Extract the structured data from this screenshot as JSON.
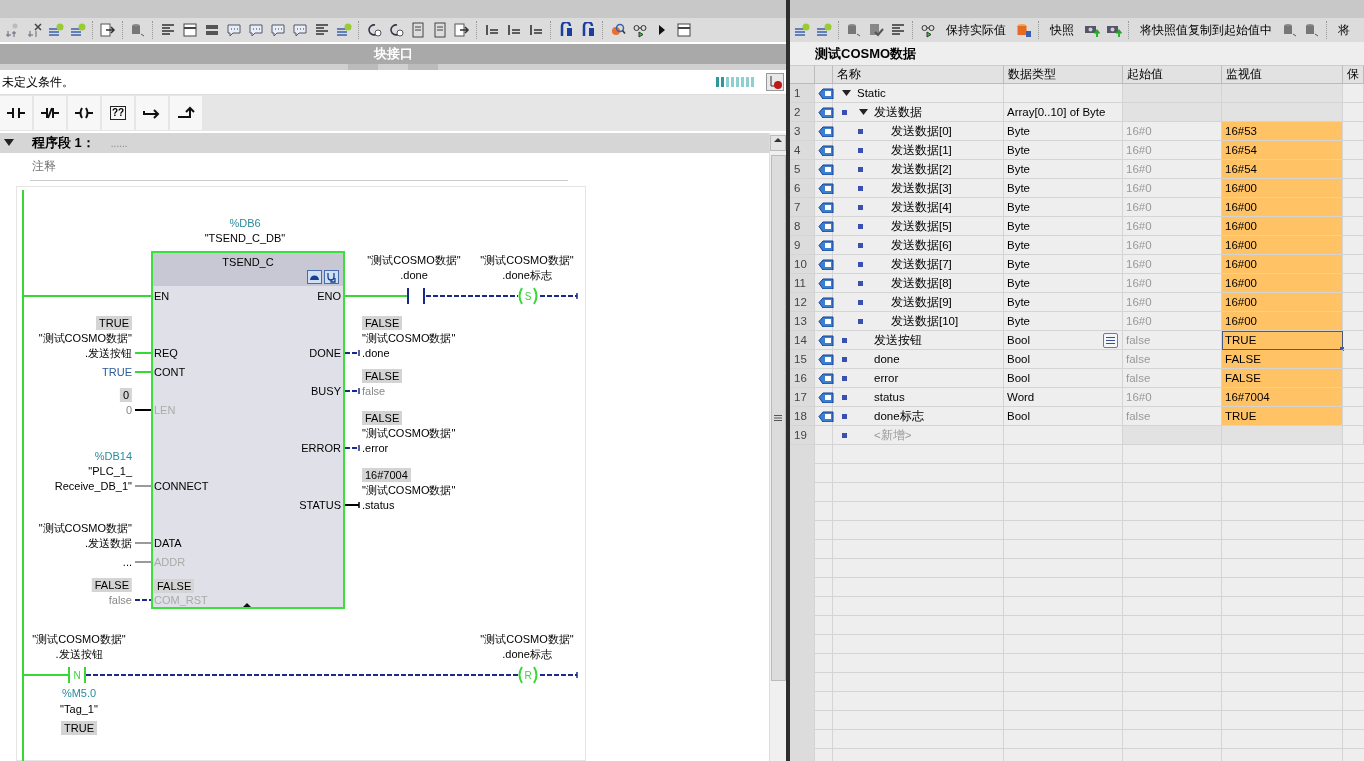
{
  "left_pane": {
    "interface_bar": "块接口",
    "condition": "未定义条件。",
    "lad_toolbar": [
      {
        "kind": "contact"
      },
      {
        "kind": "nc_contact"
      },
      {
        "kind": "coil"
      },
      {
        "kind": "box",
        "text": "??"
      },
      {
        "kind": "open_branch"
      },
      {
        "kind": "close_branch"
      }
    ],
    "network": {
      "title": "程序段 1：",
      "comment_marker": "......",
      "comment": "注释",
      "block": {
        "address": "%DB6",
        "instance": "\"TSEND_C_DB\"",
        "type": "TSEND_C",
        "inputs": [
          {
            "pin": "EN",
            "disabled": false,
            "powered": true,
            "kind": "bool"
          },
          {
            "pin": "REQ",
            "disabled": false,
            "powered": true,
            "kind": "bool",
            "operand": [
              {
                "text": "TRUE",
                "kind": "monitor"
              },
              {
                "text": "\"测试COSMO数据\"",
                "kind": "tag"
              },
              {
                "text": ".发送按钮",
                "kind": "tag"
              }
            ]
          },
          {
            "pin": "CONT",
            "disabled": false,
            "powered": true,
            "kind": "bool",
            "operand": [
              {
                "text": "TRUE",
                "kind": "constant"
              }
            ]
          },
          {
            "pin": "LEN",
            "disabled": true,
            "powered": false,
            "kind": "int",
            "operand": [
              {
                "text": "0",
                "kind": "monitor"
              },
              {
                "text": "0",
                "kind": "dim"
              }
            ]
          },
          {
            "pin": "CONNECT",
            "disabled": false,
            "powered": false,
            "kind": "struct",
            "operand": [
              {
                "text": "%DB14",
                "kind": "address"
              },
              {
                "text": "\"PLC_1_",
                "kind": "tag"
              },
              {
                "text": "Receive_DB_1\"",
                "kind": "tag"
              }
            ]
          },
          {
            "pin": "DATA",
            "disabled": false,
            "powered": false,
            "kind": "struct",
            "operand": [
              {
                "text": "\"测试COSMO数据\"",
                "kind": "tag"
              },
              {
                "text": ".发送数据",
                "kind": "tag"
              }
            ]
          },
          {
            "pin": "ADDR",
            "disabled": true,
            "powered": false,
            "kind": "struct",
            "operand": [
              {
                "text": "...",
                "kind": "tag"
              }
            ]
          },
          {
            "pin": "COM_RST",
            "disabled": true,
            "powered": false,
            "kind": "bool",
            "pin_monitor": "FALSE",
            "operand": [
              {
                "text": "FALSE",
                "kind": "monitor"
              },
              {
                "text": "false",
                "kind": "dim"
              }
            ]
          }
        ],
        "outputs": [
          {
            "pin": "ENO",
            "disabled": false,
            "powered": true,
            "kind": "bool"
          },
          {
            "pin": "DONE",
            "disabled": false,
            "powered": false,
            "kind": "bool",
            "operand": [
              {
                "text": "FALSE",
                "kind": "monitor"
              },
              {
                "text": "\"测试COSMO数据\"",
                "kind": "tag"
              },
              {
                "text": ".done",
                "kind": "tag"
              }
            ]
          },
          {
            "pin": "BUSY",
            "disabled": false,
            "powered": false,
            "kind": "bool",
            "operand": [
              {
                "text": "FALSE",
                "kind": "monitor"
              },
              {
                "text": "false",
                "kind": "dim"
              }
            ]
          },
          {
            "pin": "ERROR",
            "disabled": false,
            "powered": false,
            "kind": "bool",
            "operand": [
              {
                "text": "FALSE",
                "kind": "monitor"
              },
              {
                "text": "\"测试COSMO数据\"",
                "kind": "tag"
              },
              {
                "text": ".error",
                "kind": "tag"
              }
            ]
          },
          {
            "pin": "STATUS",
            "disabled": false,
            "powered": false,
            "kind": "int",
            "operand": [
              {
                "text": "16#7004",
                "kind": "monitor"
              },
              {
                "text": "\"测试COSMO数据\"",
                "kind": "tag"
              },
              {
                "text": ".status",
                "kind": "tag"
              }
            ]
          }
        ]
      },
      "eno_branch": {
        "contact": {
          "powered": false,
          "above": [
            {
              "text": "\"测试COSMO数据\"",
              "kind": "tag"
            },
            {
              "text": ".done",
              "kind": "tag"
            }
          ]
        },
        "coil": {
          "letter": "S",
          "powered": true,
          "above": [
            {
              "text": "\"测试COSMO数据\"",
              "kind": "tag"
            },
            {
              "text": ".done标志",
              "kind": "tag"
            }
          ]
        }
      },
      "rung_2": {
        "contact": {
          "letter": "N",
          "powered": true,
          "above": [
            {
              "text": "\"测试COSMO数据\"",
              "kind": "tag"
            },
            {
              "text": ".发送按钮",
              "kind": "tag"
            }
          ],
          "below": [
            {
              "text": "%M5.0",
              "kind": "address"
            },
            {
              "text": "\"Tag_1\"",
              "kind": "tag"
            },
            {
              "text": "TRUE",
              "kind": "monitor"
            }
          ]
        },
        "coil": {
          "letter": "R",
          "powered": true,
          "above": [
            {
              "text": "\"测试COSMO数据\"",
              "kind": "tag"
            },
            {
              "text": ".done标志",
              "kind": "tag"
            }
          ]
        }
      }
    }
  },
  "right_pane": {
    "toolbar": [
      "保持实际值",
      "快照",
      "将快照值复制到起始值中",
      "将"
    ],
    "title": "测试COSMO数据",
    "columns": [
      "名称",
      "数据类型",
      "起始值",
      "监视值",
      "保"
    ],
    "rows": [
      {
        "no": "1",
        "name": "Static",
        "expanded": true,
        "selected": false,
        "children": [
          {
            "no": "2",
            "name": "发送数据",
            "type": "Array[0..10] of Byte",
            "expanded": true,
            "selected": false,
            "children": [
              {
                "no": "3",
                "name": "发送数据[0]",
                "type": "Byte",
                "start": "16#0",
                "monitor": "16#53",
                "selected": false
              },
              {
                "no": "4",
                "name": "发送数据[1]",
                "type": "Byte",
                "start": "16#0",
                "monitor": "16#54",
                "selected": false
              },
              {
                "no": "5",
                "name": "发送数据[2]",
                "type": "Byte",
                "start": "16#0",
                "monitor": "16#54",
                "selected": false
              },
              {
                "no": "6",
                "name": "发送数据[3]",
                "type": "Byte",
                "start": "16#0",
                "monitor": "16#00",
                "selected": false
              },
              {
                "no": "7",
                "name": "发送数据[4]",
                "type": "Byte",
                "start": "16#0",
                "monitor": "16#00",
                "selected": false
              },
              {
                "no": "8",
                "name": "发送数据[5]",
                "type": "Byte",
                "start": "16#0",
                "monitor": "16#00",
                "selected": false
              },
              {
                "no": "9",
                "name": "发送数据[6]",
                "type": "Byte",
                "start": "16#0",
                "monitor": "16#00",
                "selected": false
              },
              {
                "no": "10",
                "name": "发送数据[7]",
                "type": "Byte",
                "start": "16#0",
                "monitor": "16#00",
                "selected": false
              },
              {
                "no": "11",
                "name": "发送数据[8]",
                "type": "Byte",
                "start": "16#0",
                "monitor": "16#00",
                "selected": false
              },
              {
                "no": "12",
                "name": "发送数据[9]",
                "type": "Byte",
                "start": "16#0",
                "monitor": "16#00",
                "selected": false
              },
              {
                "no": "13",
                "name": "发送数据[10]",
                "type": "Byte",
                "start": "16#0",
                "monitor": "16#00",
                "selected": false
              }
            ]
          },
          {
            "no": "14",
            "name": "发送按钮",
            "type": "Bool",
            "start": "false",
            "monitor": "TRUE",
            "selected": true
          },
          {
            "no": "15",
            "name": "done",
            "type": "Bool",
            "start": "false",
            "monitor": "FALSE",
            "selected": false
          },
          {
            "no": "16",
            "name": "error",
            "type": "Bool",
            "start": "false",
            "monitor": "FALSE",
            "selected": false
          },
          {
            "no": "17",
            "name": "status",
            "type": "Word",
            "start": "16#0",
            "monitor": "16#7004",
            "selected": false
          },
          {
            "no": "18",
            "name": "done标志",
            "type": "Bool",
            "start": "false",
            "monitor": "TRUE",
            "selected": false
          }
        ]
      }
    ],
    "add_row": {
      "no": "19",
      "label": "<新增>"
    }
  }
}
